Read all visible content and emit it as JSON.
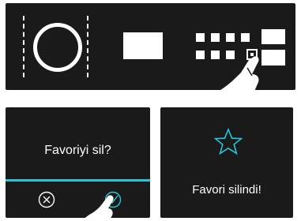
{
  "dialog": {
    "question": "Favoriyi sil?",
    "cancel_icon": "circle-x-icon",
    "confirm_icon": "circle-check-icon",
    "accent_color": "#27c5d8"
  },
  "result": {
    "message": "Favori silindi!",
    "icon": "star-outline-icon",
    "icon_color": "#27c5d8"
  },
  "top_display": {
    "icons": [
      "timer-ring-icon",
      "program-block-icon",
      "favorites-grid-icon"
    ],
    "gesture": "tap-hand-icon"
  },
  "colors": {
    "panel_bg": "#1a1a1a",
    "foreground": "#ffffff",
    "accent": "#27c5d8"
  }
}
